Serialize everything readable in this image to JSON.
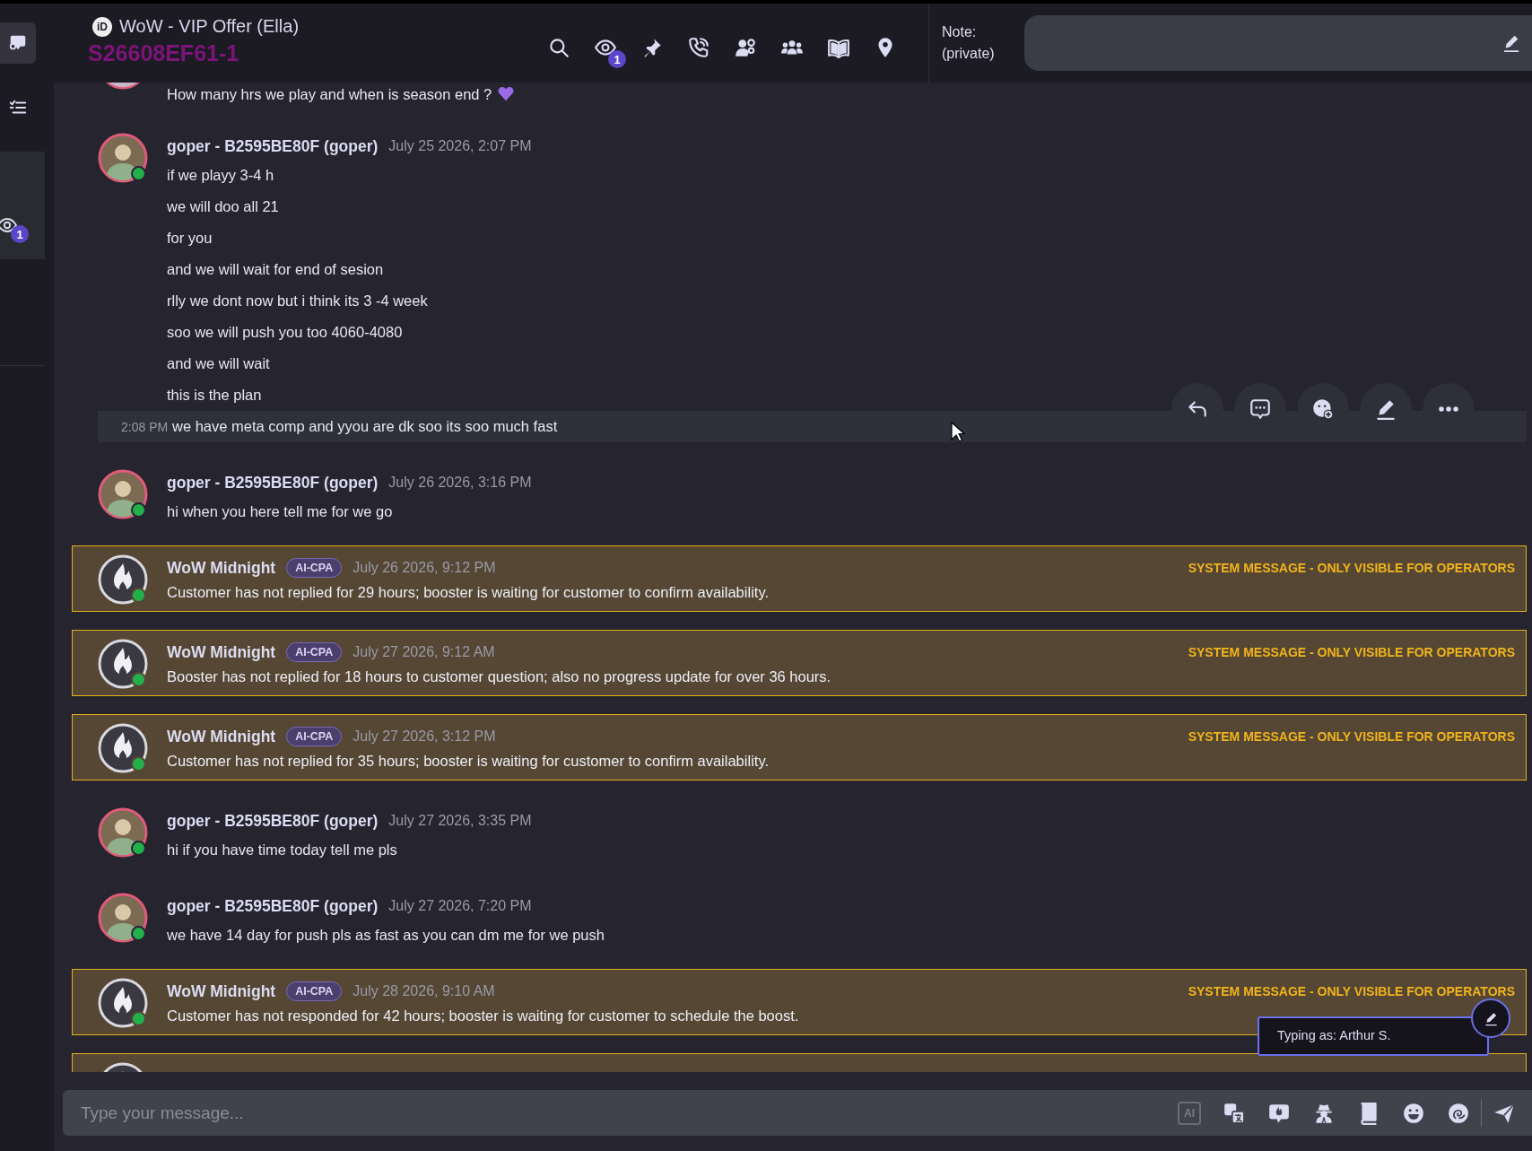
{
  "sidebar": {
    "items": [
      {
        "kind": "chats",
        "selected": true
      },
      {
        "kind": "tasks",
        "selected": false
      },
      {
        "kind": "watchers",
        "selected": false,
        "badge": "1"
      }
    ]
  },
  "header": {
    "id_badge": "iD",
    "title": "WoW - VIP Offer (Ella)",
    "order_id": "S26608EF61-1",
    "tools": [
      {
        "kind": "search"
      },
      {
        "kind": "watchers",
        "badge": "1"
      },
      {
        "kind": "pin"
      },
      {
        "kind": "call"
      },
      {
        "kind": "team-settings"
      },
      {
        "kind": "group"
      },
      {
        "kind": "book"
      },
      {
        "kind": "location"
      }
    ]
  },
  "note": {
    "label": "Note: (private)"
  },
  "messages": [
    {
      "kind": "tail",
      "lines": [
        {
          "text": "How many hrs we play and when is season end ?",
          "hovered": false,
          "heart_emoji": true
        }
      ]
    },
    {
      "kind": "user",
      "author": "goper - B2595BE80F (goper)",
      "time": "July 25 2026, 2:07 PM",
      "online": true,
      "lines": [
        {
          "text": "if we playy 3-4 h",
          "hovered": false
        },
        {
          "text": "we will doo all 21",
          "hovered": false
        },
        {
          "text": "for you",
          "hovered": false
        },
        {
          "text": "and we will wait for end of sesion",
          "hovered": false
        },
        {
          "text": "rlly we dont now but i think its 3 -4 week",
          "hovered": false
        },
        {
          "text": "soo we will push you too 4060-4080",
          "hovered": false
        },
        {
          "text": "and we will wait",
          "hovered": false
        },
        {
          "text": "this is the plan",
          "hovered": false
        },
        {
          "text": "we have meta comp and yyou are dk soo its soo much fast",
          "time": "2:08 PM",
          "hovered": true
        }
      ]
    },
    {
      "kind": "user",
      "author": "goper - B2595BE80F (goper)",
      "time": "July 26 2026, 3:16 PM",
      "online": true,
      "lines": [
        {
          "text": "hi when you here tell me for we go",
          "hovered": false
        }
      ]
    },
    {
      "kind": "system",
      "author": "WoW Midnight",
      "badge": "AI-CPA",
      "time": "July 26 2026, 9:12 PM",
      "online": true,
      "label": "SYSTEM MESSAGE - ONLY VISIBLE FOR OPERATORS",
      "text": "Customer has not replied for 29 hours; booster is waiting for customer to confirm availability."
    },
    {
      "kind": "system",
      "author": "WoW Midnight",
      "badge": "AI-CPA",
      "time": "July 27 2026, 9:12 AM",
      "online": true,
      "label": "SYSTEM MESSAGE - ONLY VISIBLE FOR OPERATORS",
      "text": "Booster has not replied for 18 hours to customer question; also no progress update for over 36 hours."
    },
    {
      "kind": "system",
      "author": "WoW Midnight",
      "badge": "AI-CPA",
      "time": "July 27 2026, 3:12 PM",
      "online": true,
      "label": "SYSTEM MESSAGE - ONLY VISIBLE FOR OPERATORS",
      "text": "Customer has not replied for 35 hours; booster is waiting for customer to confirm availability."
    },
    {
      "kind": "user",
      "author": "goper - B2595BE80F (goper)",
      "time": "July 27 2026, 3:35 PM",
      "online": true,
      "lines": [
        {
          "text": "hi if you have time today tell me pls",
          "hovered": false
        }
      ]
    },
    {
      "kind": "user",
      "author": "goper - B2595BE80F (goper)",
      "time": "July 27 2026, 7:20 PM",
      "online": true,
      "lines": [
        {
          "text": "we have 14 day for push pls as fast as you can dm me for we push",
          "hovered": false
        }
      ]
    },
    {
      "kind": "system",
      "author": "WoW Midnight",
      "badge": "AI-CPA",
      "time": "July 28 2026, 9:10 AM",
      "online": true,
      "label": "SYSTEM MESSAGE - ONLY VISIBLE FOR OPERATORS",
      "text": "Customer has not responded for 42 hours; booster is waiting for customer to schedule the boost."
    },
    {
      "kind": "system_partial"
    }
  ],
  "message_actions": [
    {
      "kind": "reply"
    },
    {
      "kind": "comment"
    },
    {
      "kind": "reaction"
    },
    {
      "kind": "edit"
    },
    {
      "kind": "more"
    }
  ],
  "typing_as": "Typing as: Arthur S.",
  "composer": {
    "placeholder": "Type your message...",
    "tools": [
      {
        "kind": "ai",
        "label": "AI"
      },
      {
        "kind": "translate"
      },
      {
        "kind": "bot-chat"
      },
      {
        "kind": "spy"
      },
      {
        "kind": "notebook"
      },
      {
        "kind": "emoji"
      },
      {
        "kind": "swirl"
      },
      {
        "kind": "send"
      }
    ]
  }
}
